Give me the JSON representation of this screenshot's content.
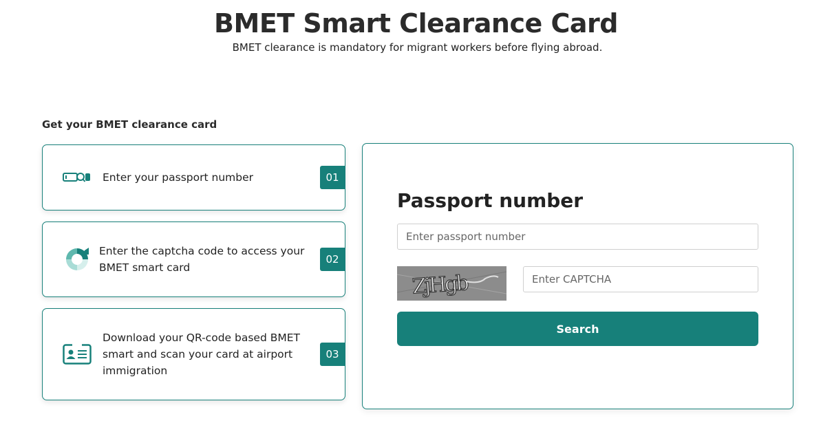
{
  "header": {
    "title": "BMET Smart Clearance Card",
    "subtitle": "BMET clearance is mandatory for migrant workers before flying abroad."
  },
  "steps_section": {
    "heading": "Get your BMET clearance card",
    "steps": [
      {
        "icon": "passport-search-icon",
        "text": "Enter your passport number",
        "number": "01"
      },
      {
        "icon": "refresh-captcha-icon",
        "text": "Enter the captcha code to access your BMET smart card",
        "number": "02"
      },
      {
        "icon": "id-card-icon",
        "text": "Download your QR-code based BMET smart and scan your card at airport immigration",
        "number": "03"
      }
    ]
  },
  "form": {
    "label": "Passport number",
    "passport_placeholder": "Enter passport number",
    "passport_value": "",
    "captcha_text": "ZjHgb",
    "captcha_placeholder": "Enter CAPTCHA",
    "captcha_value": "",
    "search_label": "Search"
  },
  "colors": {
    "accent": "#17807a",
    "text": "#222222",
    "border": "#cfcfcf"
  }
}
